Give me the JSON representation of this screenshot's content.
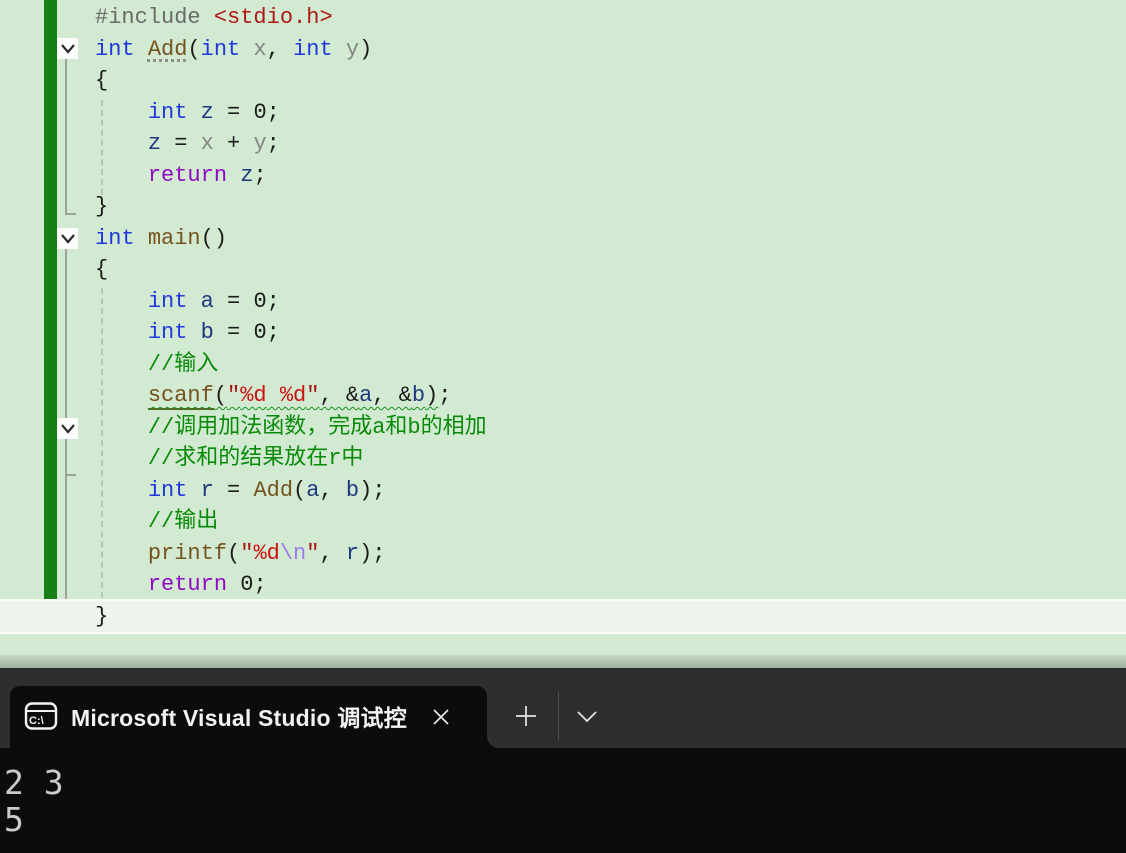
{
  "editor": {
    "background_color": "#d2ead2",
    "change_bar_color": "#168016",
    "current_line_index": 19,
    "lines": [
      {
        "tokens": [
          [
            "pp",
            "#include "
          ],
          [
            "hdr",
            "<stdio.h>"
          ]
        ]
      },
      {
        "tokens": [
          [
            "kw",
            "int"
          ],
          [
            "pun",
            " "
          ],
          [
            "fn dot",
            "Add"
          ],
          [
            "pun",
            "("
          ],
          [
            "kw",
            "int"
          ],
          [
            "par",
            " x"
          ],
          [
            "pun",
            ", "
          ],
          [
            "kw",
            "int"
          ],
          [
            "par",
            " y"
          ],
          [
            "pun",
            ")"
          ]
        ]
      },
      {
        "tokens": [
          [
            "pun",
            "{"
          ]
        ]
      },
      {
        "tokens": [
          [
            "pun",
            "    "
          ],
          [
            "kw",
            "int"
          ],
          [
            "pun",
            " "
          ],
          [
            "loc",
            "z"
          ],
          [
            "pun",
            " = "
          ],
          [
            "num",
            "0"
          ],
          [
            "pun",
            ";"
          ]
        ]
      },
      {
        "tokens": [
          [
            "pun",
            "    "
          ],
          [
            "loc",
            "z"
          ],
          [
            "pun",
            " = "
          ],
          [
            "par",
            "x"
          ],
          [
            "pun",
            " + "
          ],
          [
            "par",
            "y"
          ],
          [
            "pun",
            ";"
          ]
        ]
      },
      {
        "tokens": [
          [
            "pun",
            "    "
          ],
          [
            "ctl",
            "return"
          ],
          [
            "pun",
            " "
          ],
          [
            "loc",
            "z"
          ],
          [
            "pun",
            ";"
          ]
        ]
      },
      {
        "tokens": [
          [
            "pun",
            "}"
          ]
        ]
      },
      {
        "tokens": [
          [
            "kw",
            "int"
          ],
          [
            "pun",
            " "
          ],
          [
            "fn",
            "main"
          ],
          [
            "pun",
            "()"
          ]
        ]
      },
      {
        "tokens": [
          [
            "pun",
            "{"
          ]
        ]
      },
      {
        "tokens": [
          [
            "pun",
            "    "
          ],
          [
            "kw",
            "int"
          ],
          [
            "pun",
            " "
          ],
          [
            "loc",
            "a"
          ],
          [
            "pun",
            " = "
          ],
          [
            "num",
            "0"
          ],
          [
            "pun",
            ";"
          ]
        ]
      },
      {
        "tokens": [
          [
            "pun",
            "    "
          ],
          [
            "kw",
            "int"
          ],
          [
            "pun",
            " "
          ],
          [
            "loc",
            "b"
          ],
          [
            "pun",
            " = "
          ],
          [
            "num",
            "0"
          ],
          [
            "pun",
            ";"
          ]
        ]
      },
      {
        "tokens": [
          [
            "pun",
            "    "
          ],
          [
            "com",
            "//输入"
          ]
        ]
      },
      {
        "tokens": [
          [
            "pun",
            "    "
          ],
          [
            "fnu",
            "scanf"
          ],
          [
            "pun",
            "("
          ],
          [
            "str",
            "\""
          ],
          [
            "fmt",
            "%d"
          ],
          [
            "str",
            " "
          ],
          [
            "fmt",
            "%d"
          ],
          [
            "str",
            "\""
          ],
          [
            "pun",
            ", &"
          ],
          [
            "loc",
            "a"
          ],
          [
            "pun",
            ", &"
          ],
          [
            "loc",
            "b"
          ],
          [
            "pun",
            ")"
          ],
          [
            "pun",
            ";"
          ]
        ],
        "wavy": [
          1,
          12
        ]
      },
      {
        "tokens": [
          [
            "pun",
            "    "
          ],
          [
            "com",
            "//调用加法函数，完成a和b的相加"
          ]
        ]
      },
      {
        "tokens": [
          [
            "pun",
            "    "
          ],
          [
            "com",
            "//求和的结果放在r中"
          ]
        ]
      },
      {
        "tokens": [
          [
            "pun",
            "    "
          ],
          [
            "kw",
            "int"
          ],
          [
            "pun",
            " "
          ],
          [
            "loc",
            "r"
          ],
          [
            "pun",
            " = "
          ],
          [
            "fn",
            "Add"
          ],
          [
            "pun",
            "("
          ],
          [
            "loc",
            "a"
          ],
          [
            "pun",
            ", "
          ],
          [
            "loc",
            "b"
          ],
          [
            "pun",
            ");"
          ]
        ]
      },
      {
        "tokens": [
          [
            "pun",
            "    "
          ],
          [
            "com",
            "//输出"
          ]
        ]
      },
      {
        "tokens": [
          [
            "pun",
            "    "
          ],
          [
            "fn",
            "printf"
          ],
          [
            "pun",
            "("
          ],
          [
            "str",
            "\""
          ],
          [
            "fmt",
            "%d"
          ],
          [
            "esc",
            "\\n"
          ],
          [
            "str",
            "\""
          ],
          [
            "pun",
            ", "
          ],
          [
            "loc",
            "r"
          ],
          [
            "pun",
            ");"
          ]
        ]
      },
      {
        "tokens": [
          [
            "pun",
            "    "
          ],
          [
            "ctl",
            "return"
          ],
          [
            "pun",
            " "
          ],
          [
            "num",
            "0"
          ],
          [
            "pun",
            ";"
          ]
        ]
      },
      {
        "tokens": [
          [
            "pun",
            "}"
          ]
        ]
      }
    ]
  },
  "terminal": {
    "tab_title": "Microsoft Visual Studio 调试控",
    "output_lines": [
      "2 3",
      "5"
    ],
    "titlebar_color": "#2e2e2e",
    "background_color": "#0c0c0c",
    "icons": {
      "tab": "cmd-terminal-icon",
      "close": "close-icon",
      "new_tab": "plus-icon",
      "dropdown": "chevron-down-icon"
    }
  }
}
